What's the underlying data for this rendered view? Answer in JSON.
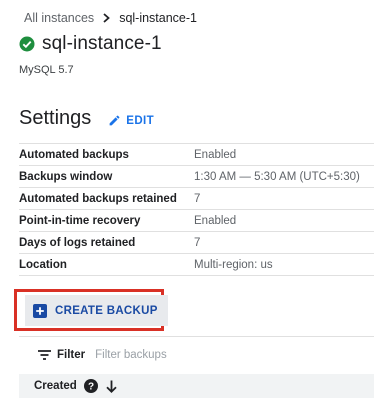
{
  "breadcrumb": {
    "parent": "All instances",
    "current": "sql-instance-1"
  },
  "instance": {
    "name": "sql-instance-1",
    "version": "MySQL 5.7",
    "status_icon": "check-circle-icon",
    "status_color": "#1e8e3e"
  },
  "settings": {
    "title": "Settings",
    "edit_label": "EDIT",
    "rows": [
      {
        "label": "Automated backups",
        "value": "Enabled"
      },
      {
        "label": "Backups window",
        "value": "1:30 AM — 5:30 AM (UTC+5:30)"
      },
      {
        "label": "Automated backups retained",
        "value": "7"
      },
      {
        "label": "Point-in-time recovery",
        "value": "Enabled"
      },
      {
        "label": "Days of logs retained",
        "value": "7"
      },
      {
        "label": "Location",
        "value": "Multi-region: us"
      }
    ]
  },
  "create_backup": {
    "label": "CREATE BACKUP",
    "highlight_color": "#d93025"
  },
  "filter": {
    "label": "Filter",
    "placeholder": "Filter backups"
  },
  "table": {
    "columns": [
      {
        "label": "Created",
        "sort": "descending"
      }
    ]
  },
  "colors": {
    "accent": "#1a73e8",
    "button_text": "#1a4aa3"
  }
}
